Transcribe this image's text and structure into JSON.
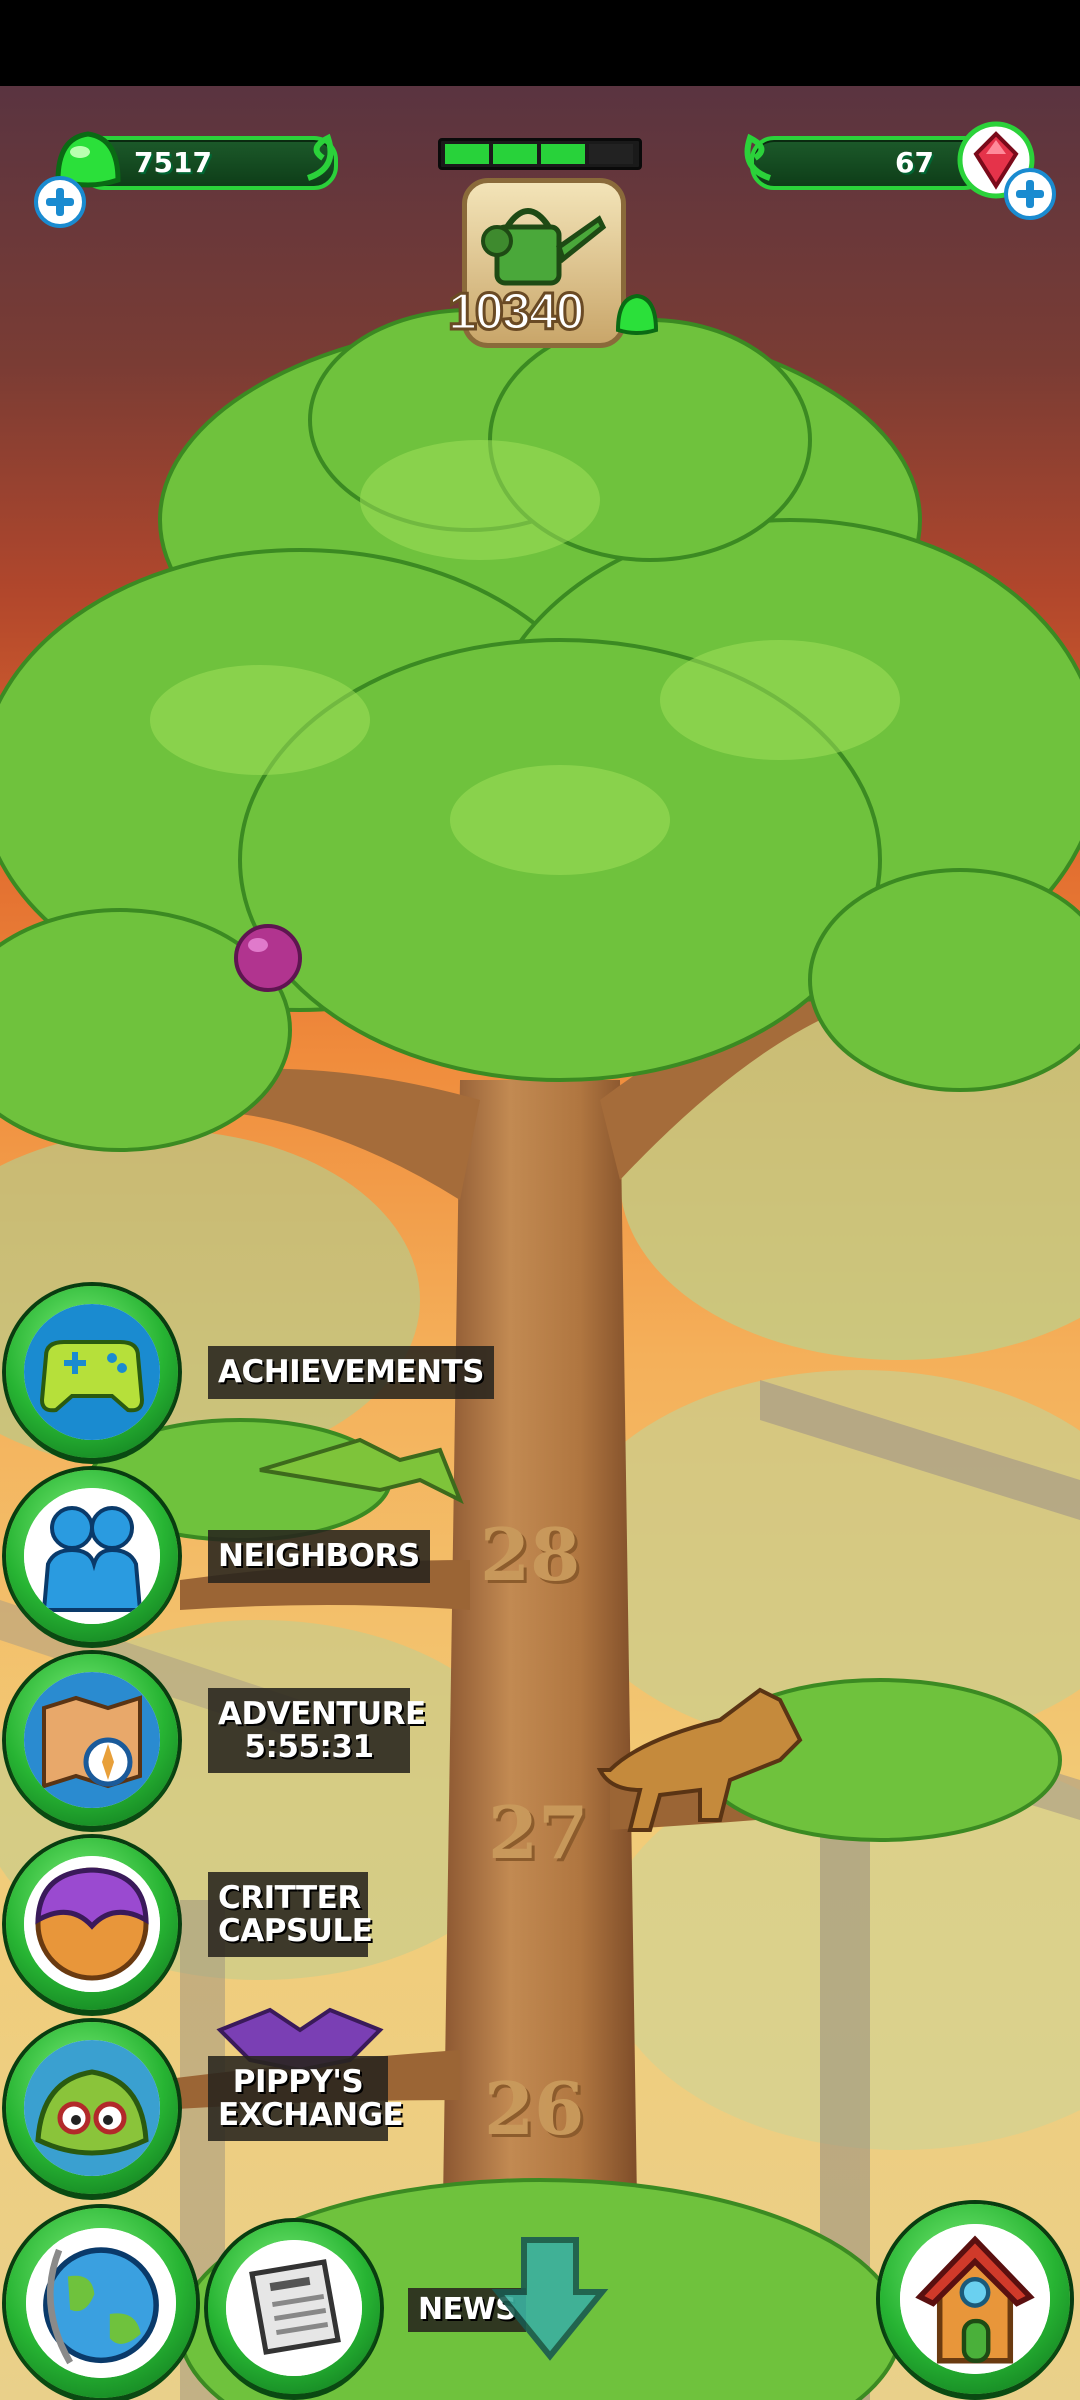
{
  "hud": {
    "currency_left": "7517",
    "currency_right": "67",
    "progress_segments_filled": 3,
    "progress_segments_total": 4,
    "watering_count": "10340"
  },
  "menu": {
    "achievements": "ACHIEVEMENTS",
    "neighbors": "NEIGHBORS",
    "adventure": "ADVENTURE",
    "adventure_timer": "5:55:31",
    "critter_capsule_1": "CRITTER",
    "critter_capsule_2": "CAPSULE",
    "pippys_exchange_1": "PIPPY'S",
    "pippys_exchange_2": "EXCHANGE",
    "news": "NEWS"
  },
  "tree_levels": [
    "28",
    "27",
    "26"
  ],
  "colors": {
    "hud_green": "#2bd23a",
    "sky_top": "#6b3a3a",
    "sky_orange": "#e0622e",
    "leaf": "#6fc23d",
    "trunk": "#b57a45"
  },
  "icons": [
    "slime-icon",
    "gem-icon",
    "watering-can-icon",
    "gamepad-icon",
    "people-icon",
    "map-compass-icon",
    "capsule-icon",
    "pippy-avatar-icon",
    "globe-icon",
    "newspaper-icon",
    "house-icon",
    "down-arrow-icon"
  ]
}
